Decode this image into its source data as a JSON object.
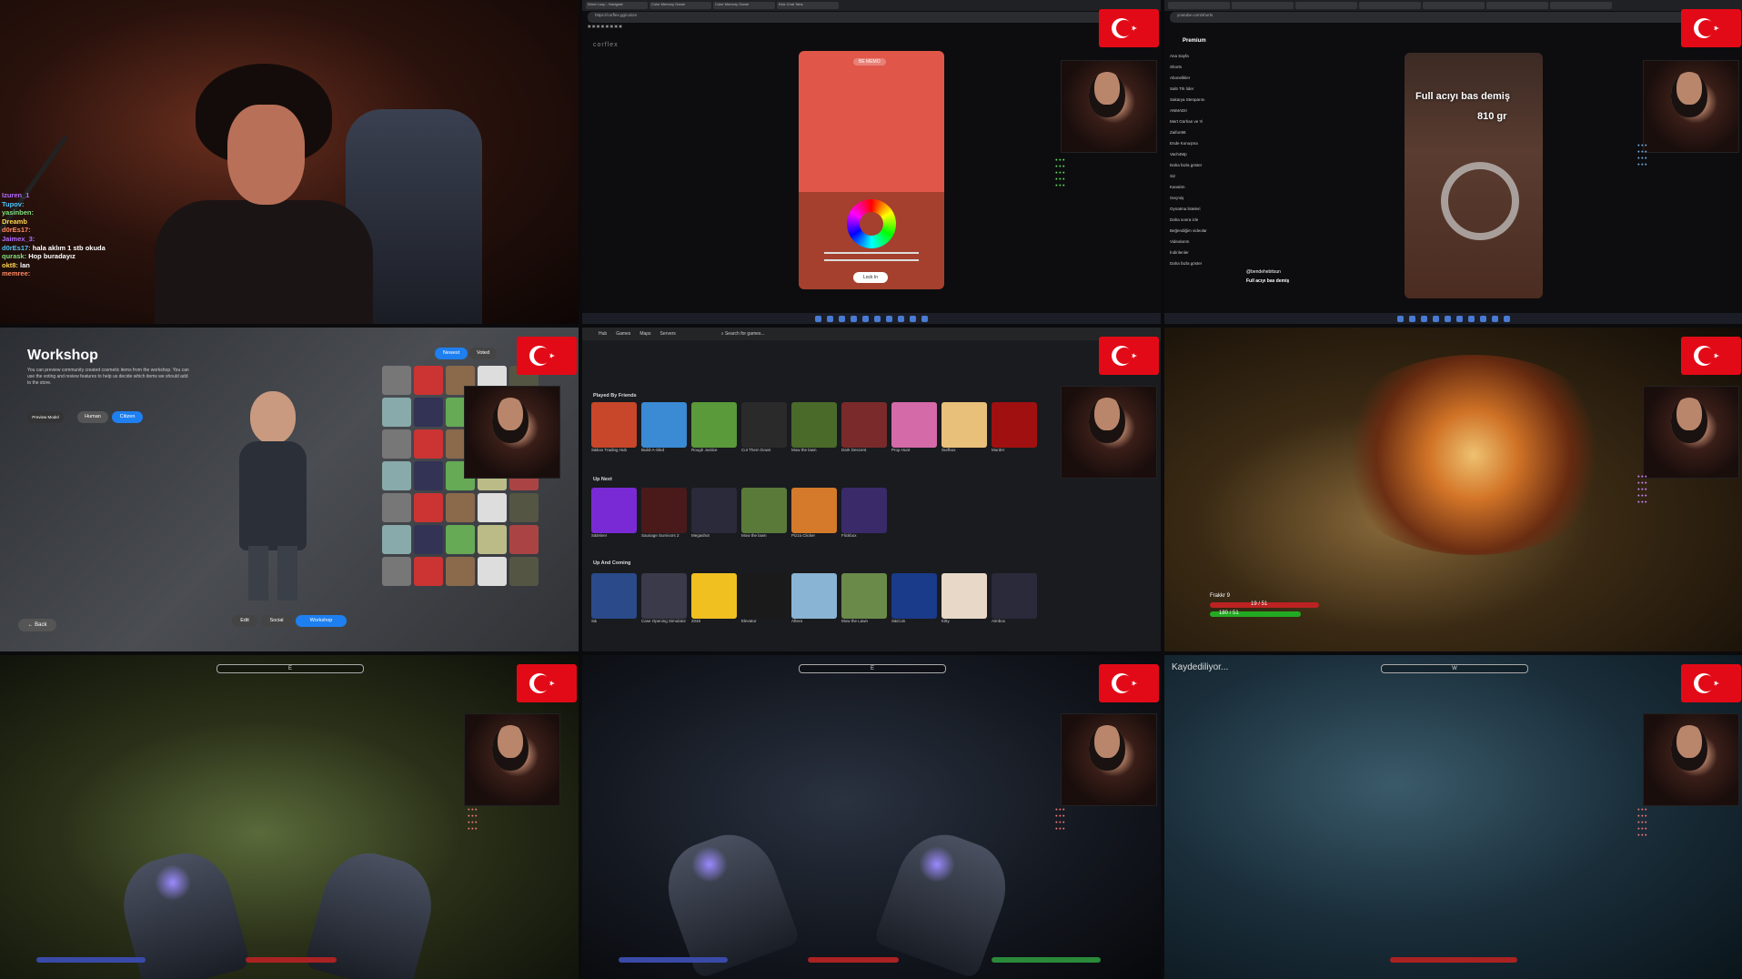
{
  "cells": {
    "cam": {
      "chat": [
        {
          "user": "Izuren_1",
          "msg": ""
        },
        {
          "user": "Tupov:",
          "msg": ""
        },
        {
          "user": "yasinben:",
          "msg": ""
        },
        {
          "user": "Dreamb",
          "msg": ""
        },
        {
          "user": "d0rEs17:",
          "msg": ""
        },
        {
          "user": "Jaimex_3:",
          "msg": ""
        },
        {
          "user": "d0rEs17:",
          "msg": "hala aklım 1 stb okuda"
        },
        {
          "user": "qurask:",
          "msg": "Hop buradayız"
        },
        {
          "user": "okt8:",
          "msg": "lan"
        },
        {
          "user": "memree:",
          "msg": ""
        }
      ]
    },
    "colorgame": {
      "tabs": [
        "Word Loop - Navigate",
        "Color Memory Game",
        "Color Memory Game",
        "Kick Chat Tabs"
      ],
      "url": "https://corflex.gg/colors",
      "brand": "corflex",
      "card_label": "BE MEMO",
      "lock_label": "Lock In"
    },
    "youtube": {
      "logo": "Premium",
      "sidebar": [
        "Ana Sayfa",
        "Shorts",
        "Abonelikler",
        "Saltı Trk lider",
        "Sakarya Stenparını",
        "ANMADII",
        "Mert Gürhan ve Yi",
        "Zaifon98",
        "Ende Konuşma",
        "Vach4Mp",
        "Daha fazla göster",
        "Siz",
        "Kanalım",
        "Geçmiş",
        "Oynatma listeleri",
        "Daha sonra izle",
        "Beğendiğim videolar",
        "Videolarım",
        "İndirilenler",
        "Daha fazla göster"
      ],
      "short_line1": "Full acıyı bas demiş",
      "short_line2": "810 gr",
      "channel": "@bendehebitsun",
      "caption": "Full acıyı bas demiş"
    },
    "workshop": {
      "title": "Workshop",
      "desc": "You can preview community created cosmetic items from the workshop. You can use the voting and review features to help us decide which items we should add to the store.",
      "newest": "Newest",
      "voted": "Voted",
      "preview_label": "Preview Model",
      "human": "Human",
      "citizen": "Citizen",
      "back": "Back",
      "edit": "Edit",
      "social": "Social",
      "workshop_btn": "Workshop"
    },
    "roblox": {
      "nav": [
        "Hub",
        "Games",
        "Maps",
        "Servers"
      ],
      "search": "Search for games...",
      "played_by_friends": "Played By Friends",
      "up_next": "Up Next",
      "up_coming": "Up And Coming",
      "friends_games": [
        "S&box Trading Hub",
        "Build-A-Sled",
        "Rough Justice",
        "Cut Them Down",
        "Mow the lawn",
        "Dark Descent",
        "Prop Hunt",
        "Surfbox",
        "Murder"
      ],
      "up_next_games": [
        "S&Miner",
        "Sausage Survivors 2",
        "Megashot",
        "Mow the lawn",
        "Pizza Clicker",
        "Flickbox"
      ],
      "coming_games": [
        "S&",
        "Case Opening Simulator",
        "2048",
        "Elevator",
        "Aftera",
        "Mow the Lawn",
        "S&Coin",
        "Kitty",
        "Aimbox"
      ]
    },
    "skyrim_fire": {
      "hp": "19 / 51",
      "stam": "180 / 51",
      "label": "Frakkr 9"
    },
    "cave": {
      "compass": "E"
    },
    "dark": {
      "compass": "E"
    },
    "blue": {
      "saving": "Kaydediliyor...",
      "compass": "W"
    }
  },
  "colors": {
    "flag_red": "#e30a17",
    "accent": "#1e7ff0"
  }
}
